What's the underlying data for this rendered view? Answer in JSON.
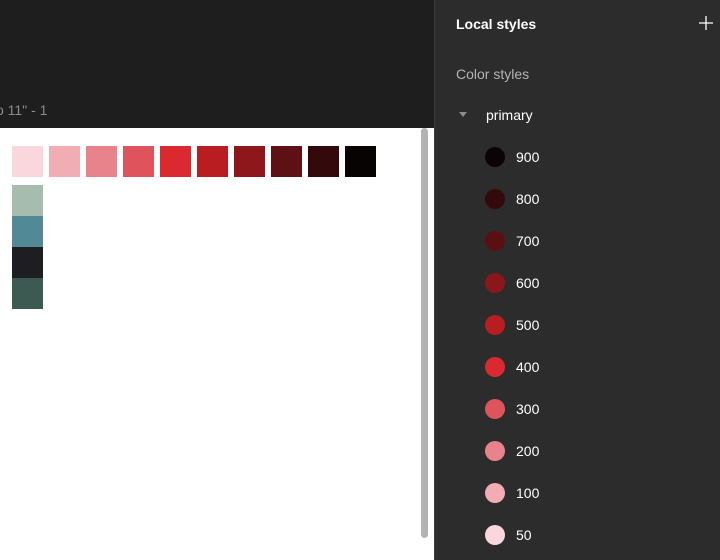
{
  "canvas": {
    "frame_label": "o 11\" - 1",
    "row_swatches": [
      {
        "name": "swatch-50",
        "color": "#f9d7dc"
      },
      {
        "name": "swatch-100",
        "color": "#f1adb3"
      },
      {
        "name": "swatch-200",
        "color": "#e8838b"
      },
      {
        "name": "swatch-300",
        "color": "#df545c"
      },
      {
        "name": "swatch-400",
        "color": "#da2a30"
      },
      {
        "name": "swatch-500",
        "color": "#b91d22"
      },
      {
        "name": "swatch-600",
        "color": "#8e171b"
      },
      {
        "name": "swatch-700",
        "color": "#5e1014"
      },
      {
        "name": "swatch-800",
        "color": "#34090b"
      },
      {
        "name": "swatch-900",
        "color": "#080303"
      }
    ],
    "column_swatches": [
      {
        "name": "swatch-sage",
        "color": "#a6bcae"
      },
      {
        "name": "swatch-teal",
        "color": "#518a96"
      },
      {
        "name": "swatch-black",
        "color": "#1e1e22"
      },
      {
        "name": "swatch-dark-green",
        "color": "#3c5a51"
      }
    ]
  },
  "panel": {
    "title": "Local styles",
    "add_icon": "plus-icon",
    "section_title": "Color styles",
    "group": {
      "label": "primary",
      "caret_icon": "caret-down-icon",
      "styles": [
        {
          "label": "900",
          "color": "#0b0406"
        },
        {
          "label": "800",
          "color": "#33090c"
        },
        {
          "label": "700",
          "color": "#5c0f13"
        },
        {
          "label": "600",
          "color": "#8c171b"
        },
        {
          "label": "500",
          "color": "#b81d22"
        },
        {
          "label": "400",
          "color": "#da2a30"
        },
        {
          "label": "300",
          "color": "#df545c"
        },
        {
          "label": "200",
          "color": "#e8838b"
        },
        {
          "label": "100",
          "color": "#f1adb3"
        },
        {
          "label": "50",
          "color": "#f9d7dc"
        }
      ]
    }
  }
}
